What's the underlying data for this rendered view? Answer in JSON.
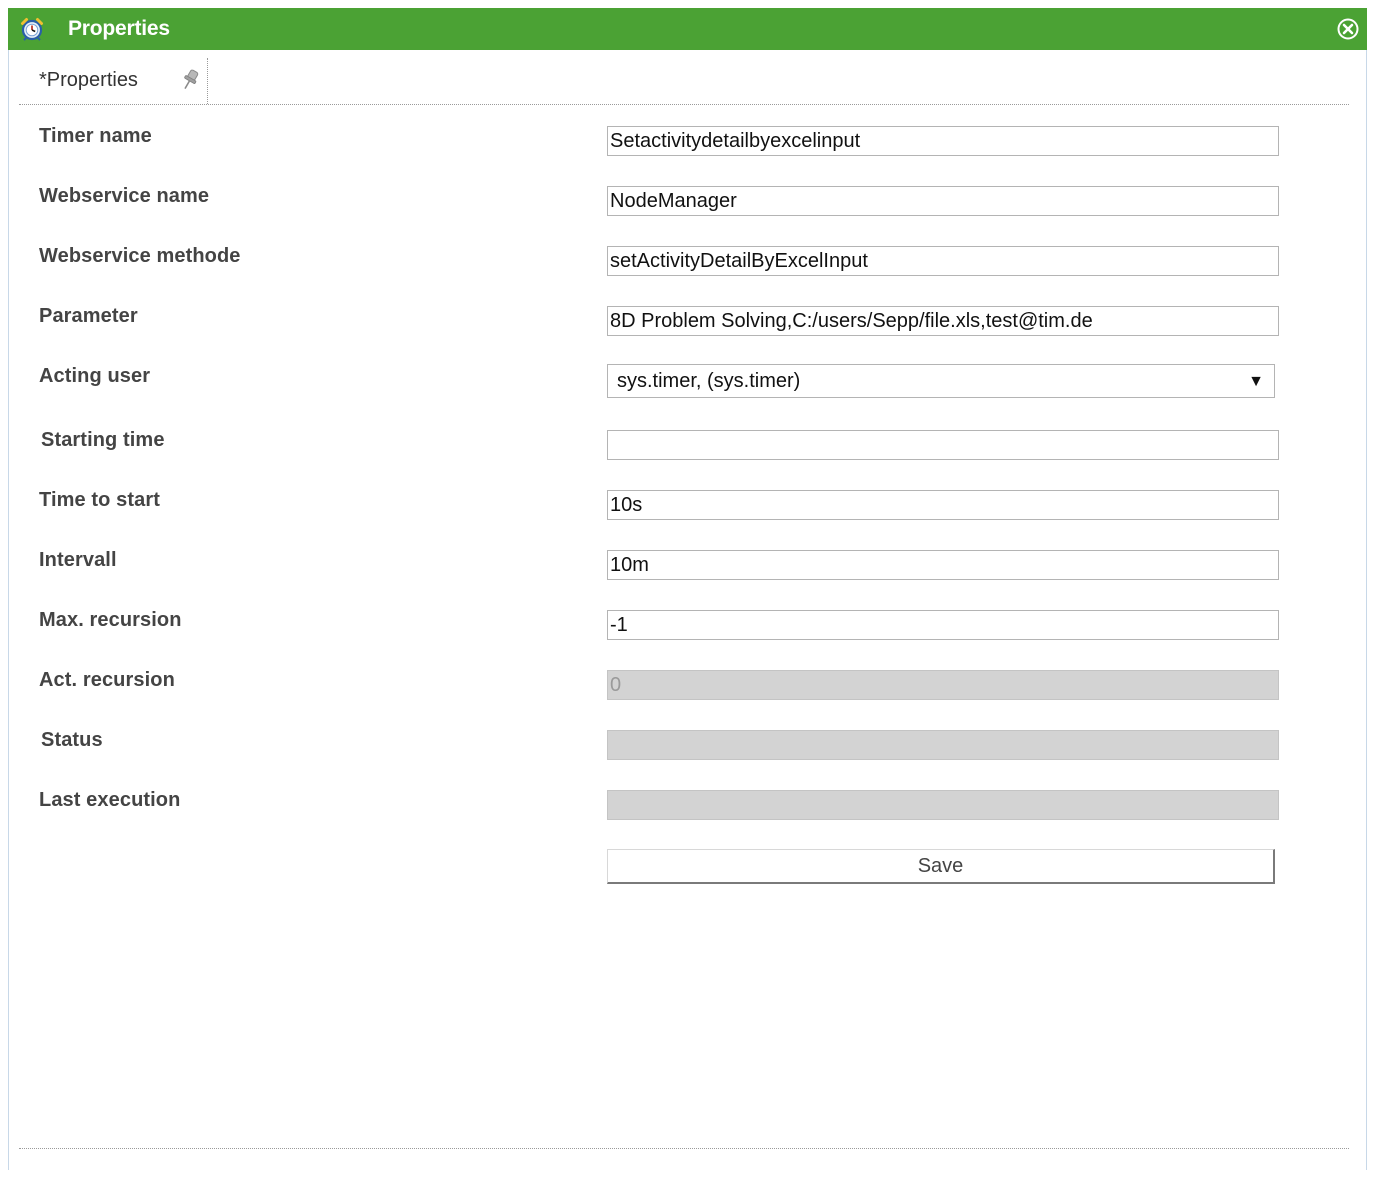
{
  "window": {
    "title": "Properties",
    "accent_color": "#4ba234"
  },
  "tabs": [
    {
      "label": "*Properties",
      "icon": "pin-icon"
    }
  ],
  "form": {
    "timer_name": {
      "label": "Timer name",
      "value": "Setactivitydetailbyexcelinput"
    },
    "webservice_name": {
      "label": "Webservice name",
      "value": "NodeManager"
    },
    "webservice_methode": {
      "label": "Webservice methode",
      "value": "setActivityDetailByExcelInput"
    },
    "parameter": {
      "label": "Parameter",
      "value": "8D Problem Solving,C:/users/Sepp/file.xls,test@tim.de"
    },
    "acting_user": {
      "label": "Acting user",
      "value": "sys.timer, (sys.timer)"
    },
    "starting_time": {
      "label": "Starting time",
      "value": ""
    },
    "time_to_start": {
      "label": "Time to start",
      "value": "10s"
    },
    "intervall": {
      "label": "Intervall",
      "value": "10m"
    },
    "max_recursion": {
      "label": "Max. recursion",
      "value": "-1"
    },
    "act_recursion": {
      "label": "Act. recursion",
      "value": "0"
    },
    "status": {
      "label": "Status",
      "value": ""
    },
    "last_execution": {
      "label": "Last execution",
      "value": ""
    }
  },
  "buttons": {
    "save_label": "Save"
  },
  "icons": {
    "title_icon": "alarm-clock-icon",
    "close_icon": "close-circle-icon",
    "select_arrow": "▼"
  }
}
